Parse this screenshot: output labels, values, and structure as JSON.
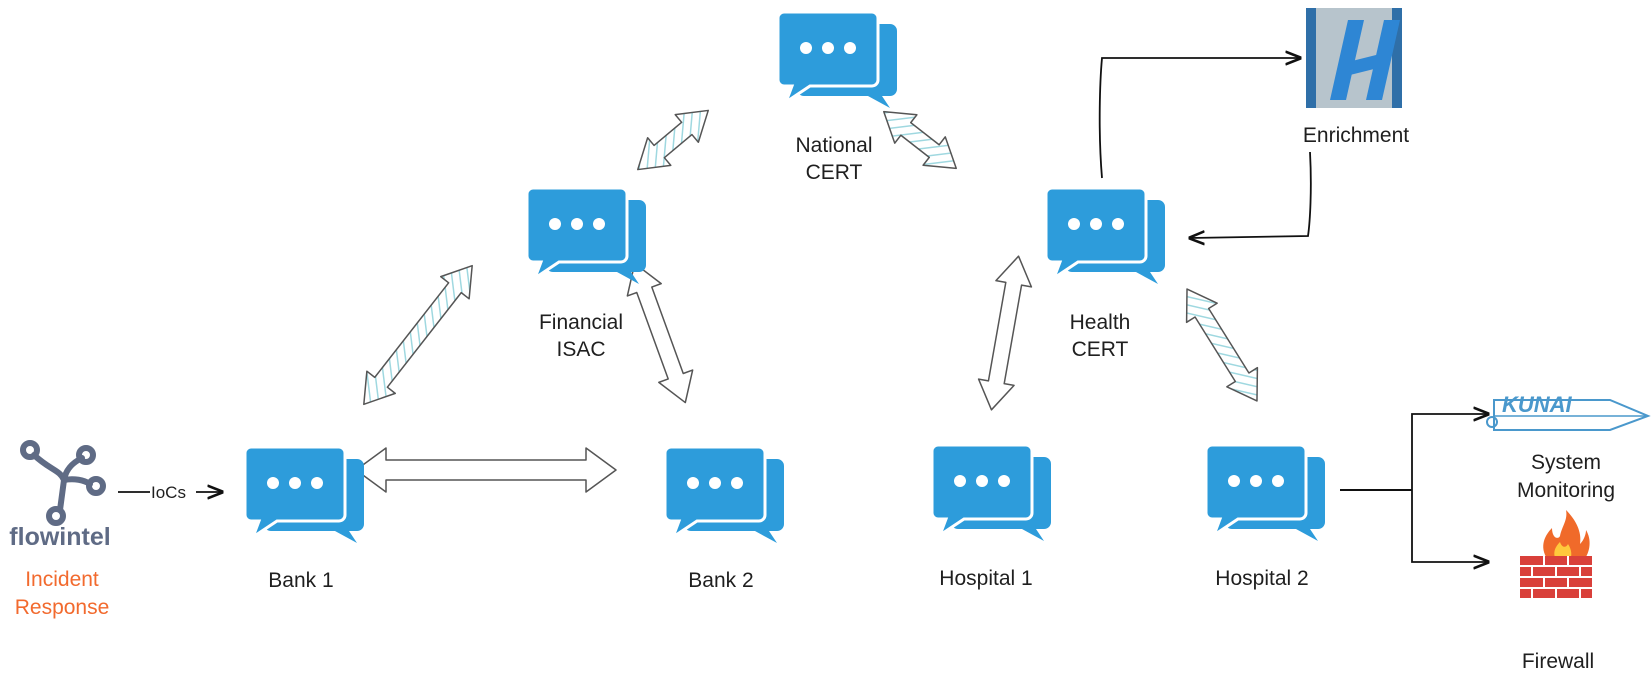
{
  "colors": {
    "chat_icon": "#2d9cdb",
    "arrow_hatch": "#9fd8e0",
    "orange_label": "#f26a2e",
    "flowintel_gray": "#5f6b85",
    "firewall_red": "#d9403a"
  },
  "nodes": {
    "national_cert": {
      "line1": "National",
      "line2": "CERT",
      "icon": "chat-bubbles-icon"
    },
    "financial_isac": {
      "line1": "Financial",
      "line2": "ISAC",
      "icon": "chat-bubbles-icon"
    },
    "health_cert": {
      "line1": "Health",
      "line2": "CERT",
      "icon": "chat-bubbles-icon"
    },
    "bank1": {
      "label": "Bank 1",
      "icon": "chat-bubbles-icon"
    },
    "bank2": {
      "label": "Bank 2",
      "icon": "chat-bubbles-icon"
    },
    "hospital1": {
      "label": "Hospital 1",
      "icon": "chat-bubbles-icon"
    },
    "hospital2": {
      "label": "Hospital 2",
      "icon": "chat-bubbles-icon"
    }
  },
  "enrichment": {
    "label": "Enrichment",
    "icon": "hive-h-logo-icon"
  },
  "flowintel": {
    "logo_text": "flowintel",
    "line1": "Incident",
    "line2": "Response",
    "icon": "flowintel-logo-icon"
  },
  "edge_iocs": {
    "label": "IoCs"
  },
  "system_monitoring": {
    "logo_text": "KUNAI",
    "line1": "System",
    "line2": "Monitoring",
    "icon": "kunai-logo-icon"
  },
  "firewall": {
    "label": "Firewall",
    "icon": "firewall-icon"
  }
}
